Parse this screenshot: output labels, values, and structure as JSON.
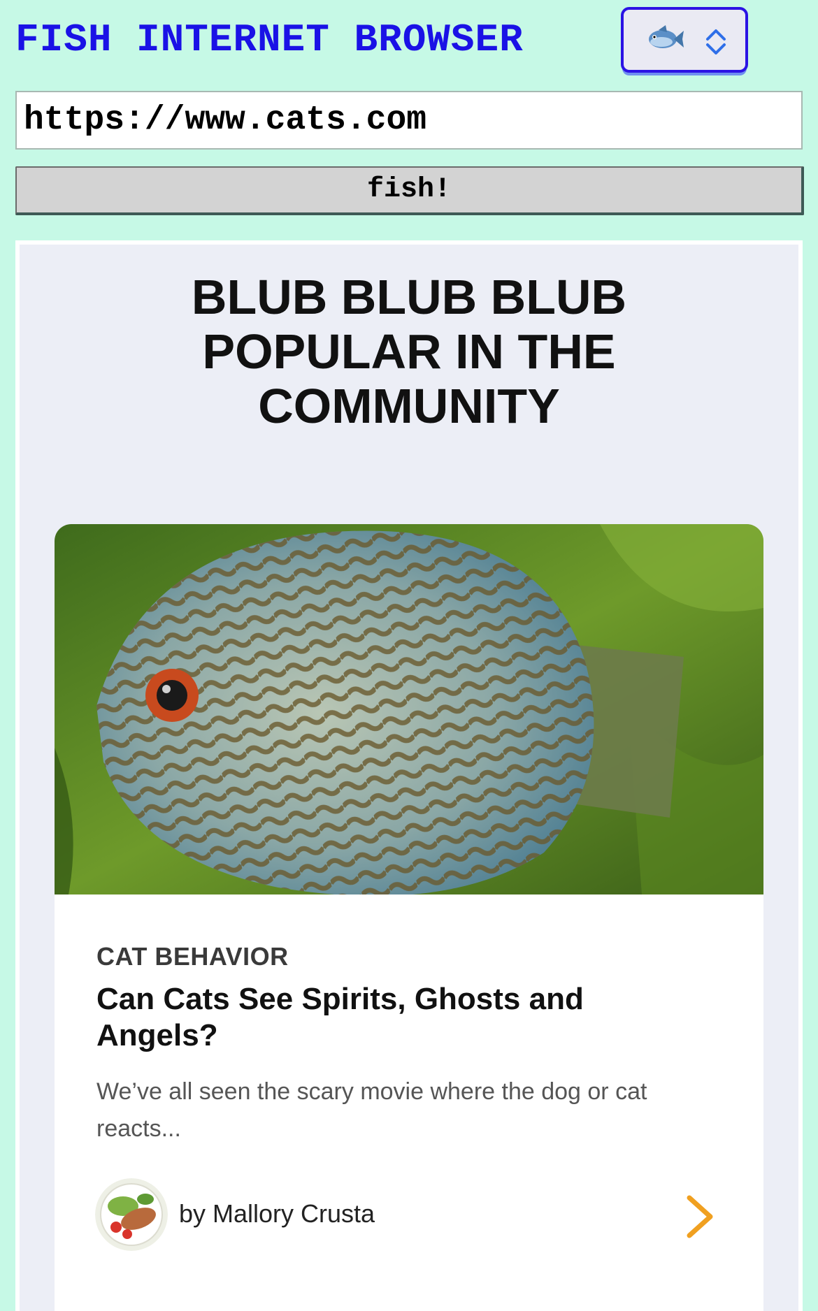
{
  "app": {
    "title": "FISH INTERNET BROWSER",
    "picker_icon": "fish-emoji",
    "picker_chevron_icon": "up-down-chevron-icon",
    "accent_color": "#2b13e4",
    "background_color": "#c6f9e6"
  },
  "address_bar": {
    "value": "https://www.cats.com"
  },
  "go_button": {
    "label": "fish!"
  },
  "page": {
    "heading": "BLUB BLUB BLUB POPULAR IN THE COMMUNITY",
    "card": {
      "image": "discus-fish-photo",
      "category": "CAT BEHAVIOR",
      "title": "Can Cats See Spirits, Ghosts and Angels?",
      "excerpt": "We’ve all seen the scary movie where the dog or cat reacts...",
      "author": "by Mallory Crusta",
      "author_avatar": "salad-plate-avatar",
      "read_more_icon": "chevron-right-icon",
      "read_more_color": "#f0a020"
    }
  }
}
